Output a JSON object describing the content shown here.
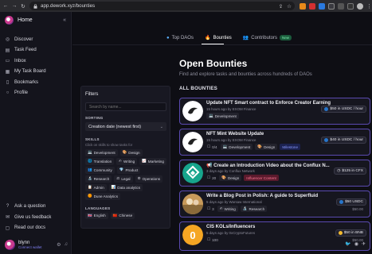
{
  "browser": {
    "url": "app.dework.xyz/bounties"
  },
  "sidebar": {
    "home_label": "Home",
    "items": [
      {
        "label": "Discover",
        "icon": "compass-icon"
      },
      {
        "label": "Task Feed",
        "icon": "feed-icon"
      },
      {
        "label": "Inbox",
        "icon": "inbox-icon"
      },
      {
        "label": "My Task Board",
        "icon": "board-icon"
      },
      {
        "label": "Bookmarks",
        "icon": "bookmark-icon"
      },
      {
        "label": "Profile",
        "icon": "user-icon"
      }
    ],
    "bottom_items": [
      {
        "label": "Ask a question",
        "icon": "question-icon"
      },
      {
        "label": "Give us feedback",
        "icon": "feedback-icon"
      },
      {
        "label": "Read our docs",
        "icon": "docs-icon"
      }
    ],
    "user": {
      "name": "blynn",
      "wallet_label": "Connect wallet"
    }
  },
  "tabs": [
    {
      "label": "Top DAOs",
      "icon": "globe-icon",
      "active": false
    },
    {
      "label": "Bounties",
      "icon": "fire-icon",
      "active": true
    },
    {
      "label": "Contributors",
      "icon": "people-icon",
      "active": false,
      "badge": "New"
    }
  ],
  "page": {
    "title": "Open Bounties",
    "subtitle": "Find and explore tasks and bounties across hundreds of DAOs",
    "list_heading": "ALL BOUNTIES"
  },
  "filters": {
    "title": "Filters",
    "search_placeholder": "Search by name...",
    "sorting_label": "SORTING",
    "sorting_value": "Creation date (newest first)",
    "skills_label": "SKILLS",
    "skills_hint": "Click on skills to show tasks for",
    "skills": [
      {
        "label": "Development",
        "icon": "💻"
      },
      {
        "label": "Design",
        "icon": "🎨"
      },
      {
        "label": "Translation",
        "icon": "🌐"
      },
      {
        "label": "Writing",
        "icon": "✍"
      },
      {
        "label": "Marketing",
        "icon": "📈"
      },
      {
        "label": "Community",
        "icon": "👥"
      },
      {
        "label": "Product",
        "icon": "💎"
      },
      {
        "label": "Research",
        "icon": "🔬"
      },
      {
        "label": "Legal",
        "icon": "⚖"
      },
      {
        "label": "Operations",
        "icon": "⚙"
      },
      {
        "label": "Admin",
        "icon": "📋"
      },
      {
        "label": "Data analytics",
        "icon": "📊"
      },
      {
        "label": "Dune Analytics",
        "icon": "🟠"
      }
    ],
    "languages_label": "LANGUAGES",
    "languages": [
      {
        "label": "English",
        "icon": "🇬🇧"
      },
      {
        "label": "Chinese",
        "icon": "🇨🇳"
      }
    ]
  },
  "bounties": [
    {
      "title": "Update NFT Smart contract to Enforce Creator Earning",
      "meta": "15 hours ago by EXOM Finance",
      "tags": [
        {
          "label": "Development",
          "kind": "skill"
        }
      ],
      "reward": "$50 in USDC / hour",
      "coin_color": "#2775ca",
      "thumb": "exom"
    },
    {
      "title": "NFT Mint Website Update",
      "meta": "15 hours ago by EXOM Finance",
      "count": "0/4",
      "tags": [
        {
          "label": "Development",
          "kind": "skill"
        },
        {
          "label": "Design",
          "kind": "skill"
        },
        {
          "label": "Milestone",
          "kind": "milestone"
        }
      ],
      "reward": "$40 in USDC / hour",
      "coin_color": "#2775ca",
      "thumb": "exom"
    },
    {
      "title": "📢 Create an Introduction Video about the Conflux N...",
      "meta": "3 days ago by Conflux Network",
      "count": "20",
      "tags": [
        {
          "label": "Design",
          "kind": "skill"
        },
        {
          "label": "Influencer Content",
          "kind": "influencer"
        }
      ],
      "reward": "$125 in CFX",
      "coin_color": "#2e9e8c",
      "thumb": "conflux"
    },
    {
      "title": "Write a Blog Post in Polish: A guide to Superfluid",
      "meta": "5 days ago by Warsaw International",
      "count": "3",
      "tags": [
        {
          "label": "Writing",
          "kind": "skill"
        },
        {
          "label": "Research",
          "kind": "skill"
        }
      ],
      "reward": "$50 USDC",
      "reward_sub": "$50.00",
      "coin_color": "#2775ca",
      "thumb": "photo"
    },
    {
      "title": "CIS KOLs/Influencers",
      "meta": "5 days ago by 0xCryptoFutures",
      "count": "100",
      "tags": [],
      "reward": "$50 in BNB",
      "reward_sub": "$50.00",
      "coin_color": "#f3ba2f",
      "thumb": "coin"
    }
  ]
}
